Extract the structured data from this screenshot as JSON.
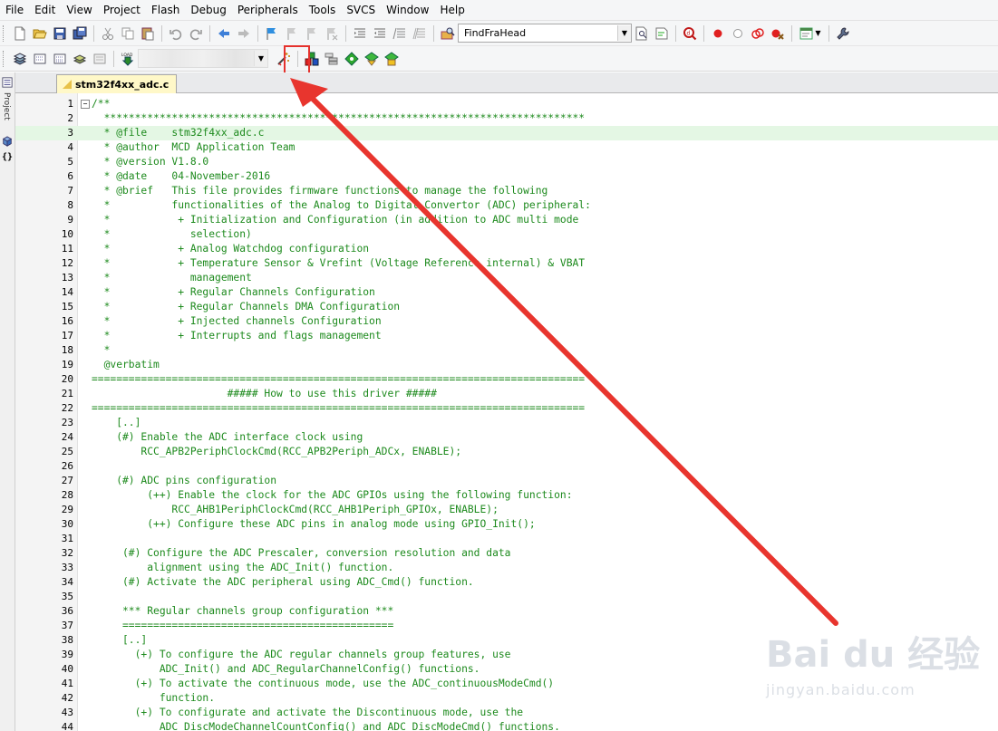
{
  "menubar": {
    "items": [
      "File",
      "Edit",
      "View",
      "Project",
      "Flash",
      "Debug",
      "Peripherals",
      "Tools",
      "SVCS",
      "Window",
      "Help"
    ]
  },
  "toolbar": {
    "find_combo_value": "FindFraHead",
    "target_combo_value": ""
  },
  "sidebar": {
    "label": "Project"
  },
  "editor": {
    "tab_label": "stm32f4xx_adc.c",
    "lines": [
      {
        "n": "1",
        "t": "/**",
        "fold": true
      },
      {
        "n": "2",
        "t": "  ******************************************************************************"
      },
      {
        "n": "3",
        "t": "  * @file    stm32f4xx_adc.c",
        "hl": true
      },
      {
        "n": "4",
        "t": "  * @author  MCD Application Team"
      },
      {
        "n": "5",
        "t": "  * @version V1.8.0"
      },
      {
        "n": "6",
        "t": "  * @date    04-November-2016"
      },
      {
        "n": "7",
        "t": "  * @brief   This file provides firmware functions to manage the following"
      },
      {
        "n": "8",
        "t": "  *          functionalities of the Analog to Digital Convertor (ADC) peripheral:"
      },
      {
        "n": "9",
        "t": "  *           + Initialization and Configuration (in addition to ADC multi mode"
      },
      {
        "n": "10",
        "t": "  *             selection)"
      },
      {
        "n": "11",
        "t": "  *           + Analog Watchdog configuration"
      },
      {
        "n": "12",
        "t": "  *           + Temperature Sensor & Vrefint (Voltage Reference internal) & VBAT"
      },
      {
        "n": "13",
        "t": "  *             management"
      },
      {
        "n": "14",
        "t": "  *           + Regular Channels Configuration"
      },
      {
        "n": "15",
        "t": "  *           + Regular Channels DMA Configuration"
      },
      {
        "n": "16",
        "t": "  *           + Injected channels Configuration"
      },
      {
        "n": "17",
        "t": "  *           + Interrupts and flags management"
      },
      {
        "n": "18",
        "t": "  *"
      },
      {
        "n": "19",
        "t": "  @verbatim"
      },
      {
        "n": "20",
        "t": "================================================================================"
      },
      {
        "n": "21",
        "t": "                      ##### How to use this driver #####"
      },
      {
        "n": "22",
        "t": "================================================================================"
      },
      {
        "n": "23",
        "t": "    [..]"
      },
      {
        "n": "24",
        "t": "    (#) Enable the ADC interface clock using"
      },
      {
        "n": "25",
        "t": "        RCC_APB2PeriphClockCmd(RCC_APB2Periph_ADCx, ENABLE);"
      },
      {
        "n": "26",
        "t": ""
      },
      {
        "n": "27",
        "t": "    (#) ADC pins configuration"
      },
      {
        "n": "28",
        "t": "         (++) Enable the clock for the ADC GPIOs using the following function:"
      },
      {
        "n": "29",
        "t": "             RCC_AHB1PeriphClockCmd(RCC_AHB1Periph_GPIOx, ENABLE);"
      },
      {
        "n": "30",
        "t": "         (++) Configure these ADC pins in analog mode using GPIO_Init();"
      },
      {
        "n": "31",
        "t": ""
      },
      {
        "n": "32",
        "t": "     (#) Configure the ADC Prescaler, conversion resolution and data"
      },
      {
        "n": "33",
        "t": "         alignment using the ADC_Init() function."
      },
      {
        "n": "34",
        "t": "     (#) Activate the ADC peripheral using ADC_Cmd() function."
      },
      {
        "n": "35",
        "t": ""
      },
      {
        "n": "36",
        "t": "     *** Regular channels group configuration ***"
      },
      {
        "n": "37",
        "t": "     ============================================"
      },
      {
        "n": "38",
        "t": "     [..]"
      },
      {
        "n": "39",
        "t": "       (+) To configure the ADC regular channels group features, use"
      },
      {
        "n": "40",
        "t": "           ADC_Init() and ADC_RegularChannelConfig() functions."
      },
      {
        "n": "41",
        "t": "       (+) To activate the continuous mode, use the ADC_continuousModeCmd()"
      },
      {
        "n": "42",
        "t": "           function."
      },
      {
        "n": "43",
        "t": "       (+) To configurate and activate the Discontinuous mode, use the"
      },
      {
        "n": "44",
        "t": "           ADC_DiscModeChannelCountConfig() and ADC_DiscModeCmd() functions."
      }
    ]
  },
  "watermark": {
    "logo": "Bai du 经验",
    "url": "jingyan.baidu.com"
  },
  "colors": {
    "comment": "#1d8a1d",
    "highlight_line": "#e4f7e4",
    "annotation_red": "#e5322d",
    "tab_bg": "#fff8c8"
  }
}
